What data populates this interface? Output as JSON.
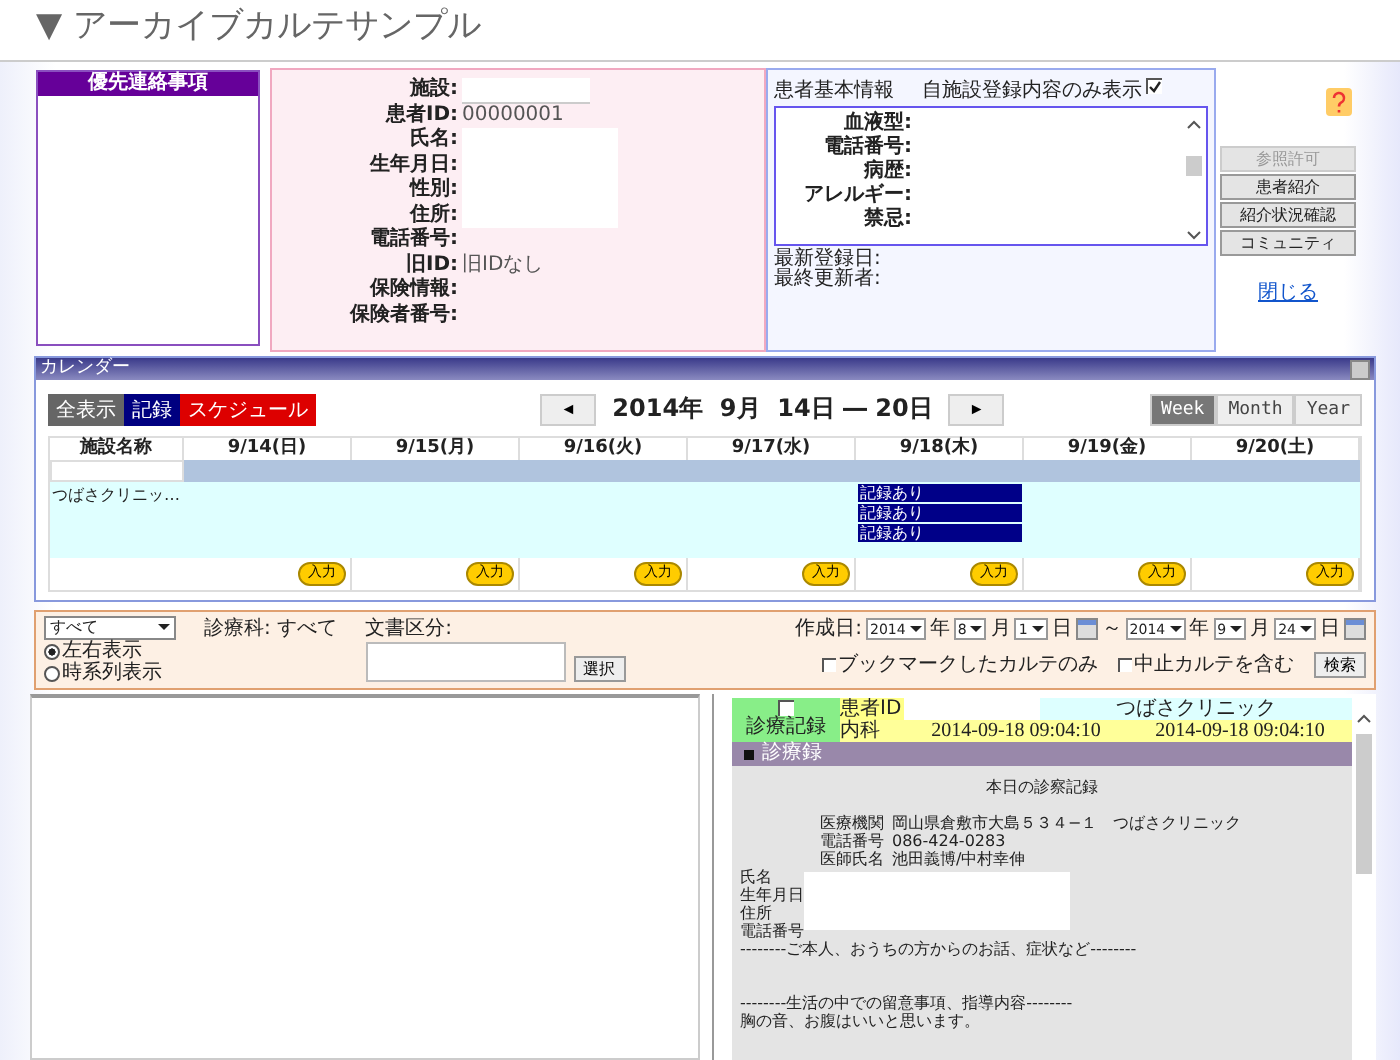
{
  "title": "▼ アーカイブカルテサンプル",
  "priority": {
    "title": "優先連絡事項"
  },
  "patient": {
    "fields": [
      {
        "label": "施設:",
        "kind": "box"
      },
      {
        "label": "患者ID:",
        "value": "00000001",
        "kind": "text"
      },
      {
        "label": "氏名:",
        "kind": "masked"
      },
      {
        "label": "生年月日:",
        "kind": "masked"
      },
      {
        "label": "性別:",
        "kind": "masked"
      },
      {
        "label": "住所:",
        "kind": "masked"
      },
      {
        "label": "電話番号:",
        "kind": "text"
      },
      {
        "label": "旧ID:",
        "value": "旧IDなし",
        "kind": "text"
      },
      {
        "label": "保険情報:",
        "kind": "text"
      },
      {
        "label": "保険者番号:",
        "kind": "text"
      }
    ]
  },
  "basic_info": {
    "title": "患者基本情報",
    "own_only": {
      "label": "自施設登録内容のみ表示",
      "checked": true
    },
    "fields": [
      "血液型:",
      "電話番号:",
      "病歴:",
      "アレルギー:",
      "禁忌:"
    ],
    "footer": [
      "最新登録日:",
      "最終更新者:"
    ]
  },
  "side_buttons": [
    {
      "label": "参照許可",
      "disabled": true
    },
    {
      "label": "患者紹介",
      "disabled": false
    },
    {
      "label": "紹介状況確認",
      "disabled": false
    },
    {
      "label": "コミュニティ",
      "disabled": false
    }
  ],
  "close_link": "閉じる",
  "calendar": {
    "title": "カレンダー",
    "filters": [
      {
        "label": "全表示",
        "color": "#666666"
      },
      {
        "label": "記録",
        "color": "#000080"
      },
      {
        "label": "スケジュール",
        "color": "#dd0000"
      }
    ],
    "period": "2014年  9月  14日 ― 20日",
    "prev": "◄",
    "next": "►",
    "views": [
      {
        "label": "Week",
        "selected": true
      },
      {
        "label": "Month",
        "selected": false
      },
      {
        "label": "Year",
        "selected": false
      }
    ],
    "facility_header": "施設名称",
    "days": [
      {
        "label": "9/14(日)",
        "input_button": "入力"
      },
      {
        "label": "9/15(月)",
        "input_button": "入力"
      },
      {
        "label": "9/16(火)",
        "input_button": "入力"
      },
      {
        "label": "9/17(水)",
        "input_button": "入力"
      },
      {
        "label": "9/18(木)",
        "input_button": "入力",
        "records": [
          "記録あり",
          "記録あり",
          "記録あり"
        ]
      },
      {
        "label": "9/19(金)",
        "input_button": "入力"
      },
      {
        "label": "9/20(土)",
        "input_button": "入力"
      }
    ],
    "facility": "つばさクリニッ…"
  },
  "filter": {
    "select": "すべて",
    "layouts": [
      {
        "label": "左右表示",
        "selected": true
      },
      {
        "label": "時系列表示",
        "selected": false
      }
    ],
    "dept_label": "診療科:",
    "dept": "すべて",
    "doc_label": "文書区分:",
    "choose": "選択",
    "date_label": "作成日:",
    "from": [
      {
        "value": "2014",
        "unit": "年"
      },
      {
        "value": "8",
        "unit": "月"
      },
      {
        "value": "1",
        "unit": "日"
      }
    ],
    "tilde": "～",
    "to": [
      {
        "value": "2014",
        "unit": "年"
      },
      {
        "value": "9",
        "unit": "月"
      },
      {
        "value": "24",
        "unit": "日"
      }
    ],
    "checks": [
      {
        "label": "ブックマークしたカルテのみ",
        "checked": false
      },
      {
        "label": "中止カルテを含む",
        "checked": false
      }
    ],
    "search": "検索"
  },
  "record": {
    "checked": false,
    "type": "診療記録",
    "id_label": "患者ID",
    "clinic": "つばさクリニック",
    "dept": "内科",
    "created": "2014-09-18 09:04:10",
    "updated": "2014-09-18 09:04:10",
    "section": "診療録",
    "doc_title": "本日の診察記録",
    "header": [
      {
        "label": "医療機関",
        "value": "岡山県倉敷市大島５３４−１　つばさクリニック"
      },
      {
        "label": "電話番号",
        "value": "086-424-0283"
      },
      {
        "label": "医師氏名",
        "value": "池田義博/中村幸伸"
      }
    ],
    "patient_labels": [
      "氏名",
      "生年月日",
      "住所",
      "電話番号"
    ],
    "body": [
      [
        "--------ご本人、おうちの方からのお話、症状など--------"
      ],
      [
        "--------生活の中での留意事項、指導内容--------",
        "胸の音、お腹はいいと思います。"
      ]
    ]
  }
}
